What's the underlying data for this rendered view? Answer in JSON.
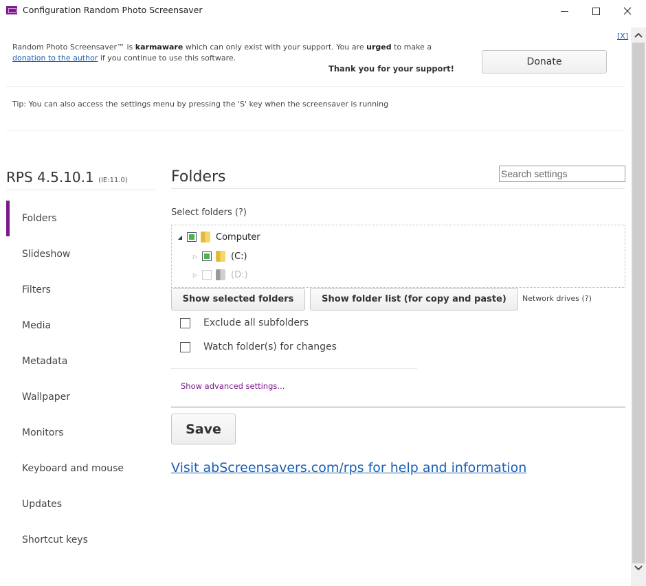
{
  "window": {
    "title": "Configuration Random Photo Screensaver",
    "app_icon": "rps-app-icon",
    "controls": {
      "minimize": "minimize-icon",
      "maximize": "maximize-icon",
      "close": "close-icon"
    }
  },
  "banner": {
    "close_label": "[X]",
    "line_parts": {
      "p1": "Random Photo Screensaver™ is ",
      "b1": "karmaware",
      "p2": " which can only exist with your support. You are ",
      "b2": "urged",
      "p3": " to make a ",
      "link": "donation to the author",
      "p4": " if you continue to use this software."
    },
    "thanks": "Thank you for your support!",
    "donate_label": "Donate"
  },
  "tip": "Tip: You can also access the settings menu by pressing the 'S' key when the screensaver is running",
  "sidebar": {
    "version": "RPS 4.5.10.1",
    "ie_version": "(IE:11.0)",
    "accent_color": "#7b1a8c",
    "items": [
      {
        "label": "Folders",
        "active": true
      },
      {
        "label": "Slideshow"
      },
      {
        "label": "Filters"
      },
      {
        "label": "Media"
      },
      {
        "label": "Metadata"
      },
      {
        "label": "Wallpaper"
      },
      {
        "label": "Monitors"
      },
      {
        "label": "Keyboard and mouse"
      },
      {
        "label": "Updates"
      },
      {
        "label": "Shortcut keys"
      }
    ]
  },
  "main": {
    "title": "Folders",
    "search_placeholder": "Search settings",
    "select_label": "Select folders (?)",
    "tree": [
      {
        "label": "Computer",
        "expanded": true,
        "state": "partial",
        "enabled": true
      },
      {
        "label": "(C:)",
        "expanded": false,
        "state": "partial",
        "enabled": true
      },
      {
        "label": "(D:)",
        "expanded": false,
        "state": "unchecked",
        "enabled": false
      }
    ],
    "buttons": {
      "show_selected": "Show selected folders",
      "show_list": "Show folder list (for copy and paste)"
    },
    "network_drives": "Network drives (?)",
    "options": [
      {
        "label": "Exclude all subfolders",
        "checked": false
      },
      {
        "label": "Watch folder(s) for changes",
        "checked": false
      }
    ],
    "advanced_link": "Show advanced settings...",
    "save_label": "Save",
    "help_link": "Visit abScreensavers.com/rps for help and information"
  }
}
